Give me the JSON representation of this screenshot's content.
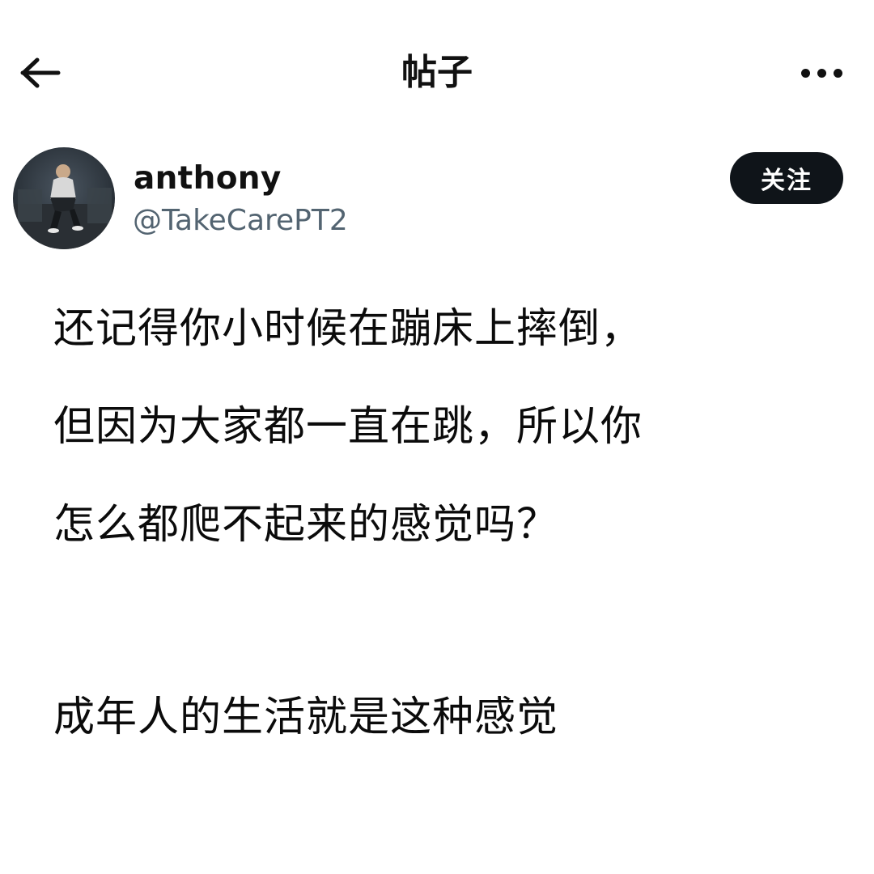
{
  "header": {
    "title": "帖子",
    "back_icon": "arrow-left-icon",
    "more_icon": "more-horizontal-icon"
  },
  "author": {
    "display_name": "anthony",
    "handle": "@TakeCarePT2",
    "follow_label": "关注"
  },
  "post": {
    "lines": [
      "还记得你小时候在蹦床上摔倒，",
      "但因为大家都一直在跳，所以你",
      "怎么都爬不起来的感觉吗？",
      "成年人的生活就是这种感觉"
    ]
  },
  "colors": {
    "text_primary": "#0f1419",
    "text_secondary": "#536471",
    "follow_bg": "#0f1419",
    "follow_text": "#ffffff"
  }
}
